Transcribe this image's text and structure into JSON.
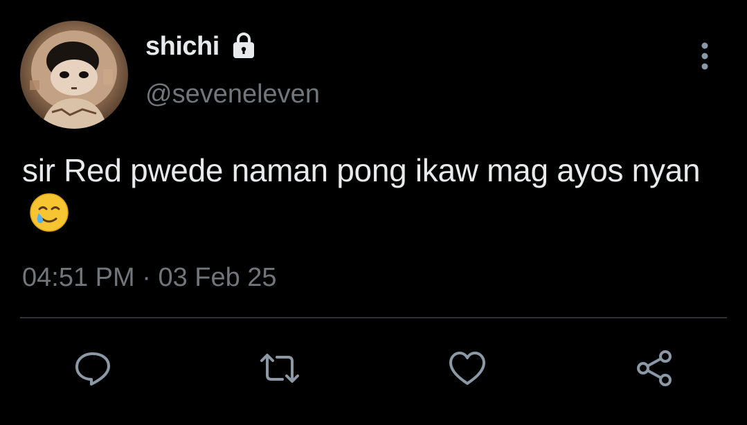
{
  "author": {
    "display_name": "shichi",
    "handle": "@seveneleven",
    "protected": true
  },
  "tweet": {
    "text": "sir Red pwede naman pong ikaw mag ayos nyan",
    "emoji": "smiling-face-with-tear",
    "time": "04:51 PM",
    "separator": "·",
    "date": "03 Feb 25"
  },
  "actions": [
    "reply-icon",
    "retweet-icon",
    "like-icon",
    "share-icon"
  ],
  "colors": {
    "background": "#000000",
    "primary_text": "#e7e9ea",
    "secondary_text": "#71767b",
    "divider": "#2f3336",
    "icon": "#8b98a5"
  }
}
